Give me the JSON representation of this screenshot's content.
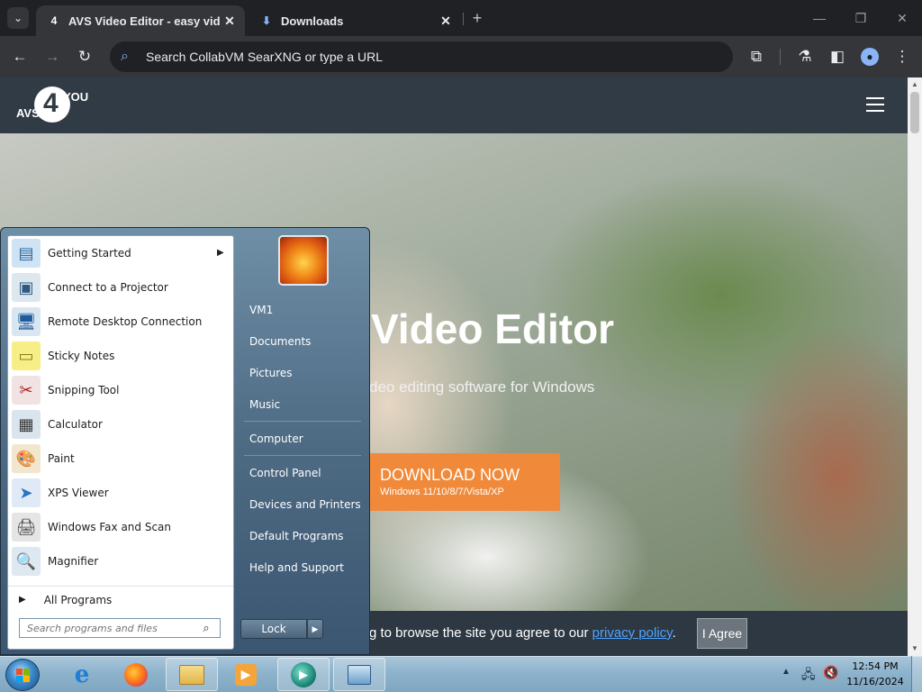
{
  "browser": {
    "tabs": [
      {
        "favicon": "avs4you-favicon",
        "title": "AVS Video Editor - easy video",
        "active": true
      },
      {
        "favicon": "download-icon",
        "title": "Downloads",
        "active": false
      }
    ],
    "omnibox_placeholder": "Search CollabVM SearXNG or type a URL"
  },
  "site": {
    "logo_text_main": "4",
    "logo_text_avs": "AVS",
    "logo_text_you": "YOU",
    "hero_title": "Video Editor",
    "hero_subtitle": "deo editing software for Windows",
    "download_label": "DOWNLOAD NOW",
    "download_sub": "Windows 11/10/8/7/Vista/XP",
    "cookie_prefix": "g to browse the site you agree to our",
    "cookie_link": "privacy policy",
    "cookie_suffix": ".",
    "agree_label": "I Agree"
  },
  "start_menu": {
    "programs": [
      {
        "label": "Getting Started",
        "icon": "getting-started-icon",
        "has_submenu": true
      },
      {
        "label": "Connect to a Projector",
        "icon": "projector-icon"
      },
      {
        "label": "Remote Desktop Connection",
        "icon": "remote-desktop-icon"
      },
      {
        "label": "Sticky Notes",
        "icon": "sticky-notes-icon"
      },
      {
        "label": "Snipping Tool",
        "icon": "snipping-tool-icon"
      },
      {
        "label": "Calculator",
        "icon": "calculator-icon"
      },
      {
        "label": "Paint",
        "icon": "paint-icon"
      },
      {
        "label": "XPS Viewer",
        "icon": "xps-viewer-icon"
      },
      {
        "label": "Windows Fax and Scan",
        "icon": "fax-scan-icon"
      },
      {
        "label": "Magnifier",
        "icon": "magnifier-icon"
      }
    ],
    "all_programs": "All Programs",
    "search_placeholder": "Search programs and files",
    "right_items": [
      "VM1",
      "Documents",
      "Pictures",
      "Music",
      "Computer",
      "Control Panel",
      "Devices and Printers",
      "Default Programs",
      "Help and Support"
    ],
    "lock_label": "Lock"
  },
  "taskbar": {
    "time": "12:54 PM",
    "date": "11/16/2024"
  }
}
